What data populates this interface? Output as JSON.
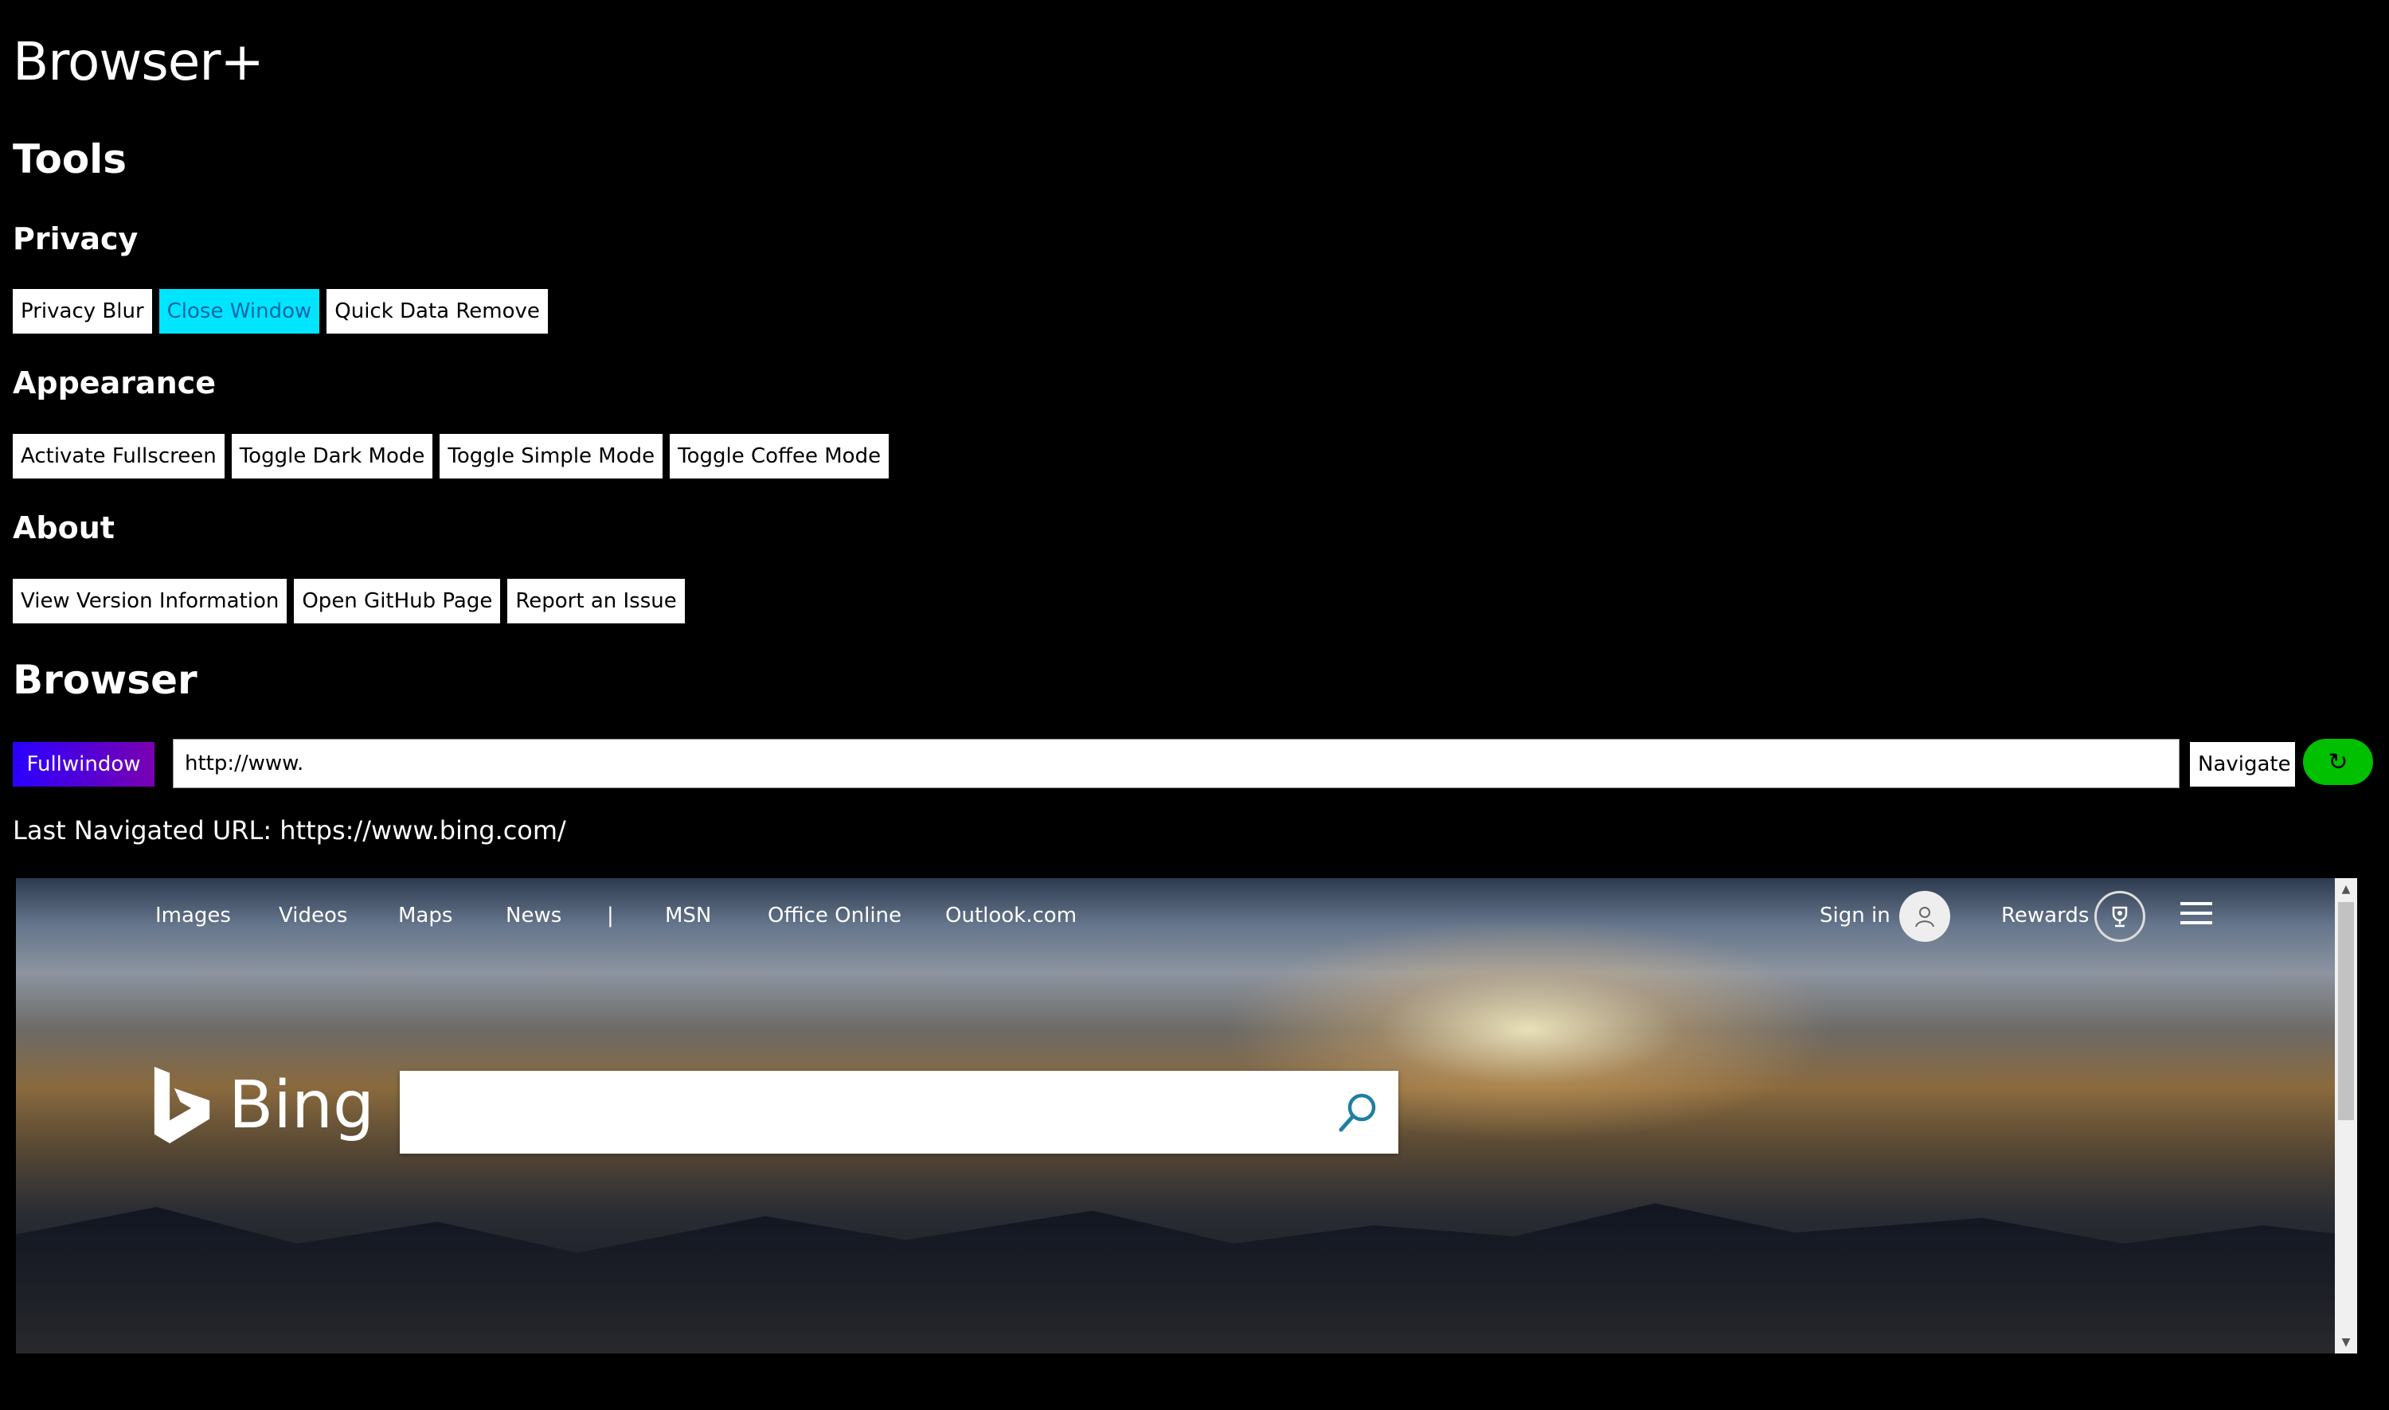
{
  "app": {
    "title": "Browser+"
  },
  "tools": {
    "heading": "Tools",
    "privacy": {
      "heading": "Privacy",
      "buttons": [
        "Privacy Blur",
        "Close Window",
        "Quick Data Remove"
      ]
    },
    "appearance": {
      "heading": "Appearance",
      "buttons": [
        "Activate Fullscreen",
        "Toggle Dark Mode",
        "Toggle Simple Mode",
        "Toggle Coffee Mode"
      ]
    },
    "about": {
      "heading": "About",
      "buttons": [
        "View Version Information",
        "Open GitHub Page",
        "Report an Issue"
      ]
    }
  },
  "browser": {
    "heading": "Browser",
    "fullwindow_label": "Fullwindow",
    "url_value": "http://www.",
    "navigate_label": "Navigate",
    "refresh_glyph": "↻",
    "last_navigated": "Last Navigated URL: https://www.bing.com/"
  },
  "bing": {
    "nav_links": [
      "Images",
      "Videos",
      "Maps",
      "News",
      "|",
      "MSN",
      "Office Online",
      "Outlook.com"
    ],
    "sign_in": "Sign in",
    "rewards": "Rewards",
    "logo_text": "Bing",
    "search_placeholder": ""
  },
  "colors": {
    "active_button": "#00e5ff",
    "fullwindow_start": "#2a00ff",
    "fullwindow_end": "#7a00b0",
    "refresh": "#00c000"
  }
}
